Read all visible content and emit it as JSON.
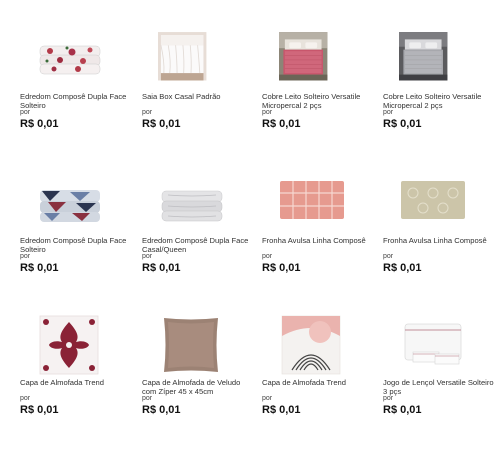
{
  "currency_prefix_label": "por",
  "products": [
    {
      "name": "Edredom Composê Dupla Face Solteiro",
      "price": "R$ 0,01",
      "icon": "folded-comforter-floral"
    },
    {
      "name": "Saia Box Casal Padrão",
      "price": "R$ 0,01",
      "icon": "bed-skirt"
    },
    {
      "name": "Cobre Leito Solteiro Versatile Micropercal 2 pçs",
      "price": "R$ 0,01",
      "icon": "bedspread-pink"
    },
    {
      "name": "Cobre Leito Solteiro Versatile Micropercal 2 pçs",
      "price": "R$ 0,01",
      "icon": "bedspread-grey"
    },
    {
      "name": "Edredom Composê Dupla Face Solteiro",
      "price": "R$ 0,01",
      "icon": "folded-comforter-geometric"
    },
    {
      "name": "Edredom Composê Dupla Face Casal/Queen",
      "price": "R$ 0,01",
      "icon": "folded-comforter-grey"
    },
    {
      "name": "Fronha Avulsa Linha Composê",
      "price": "R$ 0,01",
      "icon": "pillowcase-plaid"
    },
    {
      "name": "Fronha Avulsa Linha Composê",
      "price": "R$ 0,01",
      "icon": "pillowcase-damask"
    },
    {
      "name": "Capa de Almofada Trend",
      "price": "R$ 0,01",
      "icon": "cushion-damask"
    },
    {
      "name": "Capa de Almofada de Veludo com Zíper 45 x 45cm",
      "price": "R$ 0,01",
      "icon": "cushion-velvet"
    },
    {
      "name": "Capa de Almofada Trend",
      "price": "R$ 0,01",
      "icon": "cushion-arches"
    },
    {
      "name": "Jogo de Lençol Versatile Solteiro 3 pçs",
      "price": "R$ 0,01",
      "icon": "sheet-set"
    }
  ]
}
